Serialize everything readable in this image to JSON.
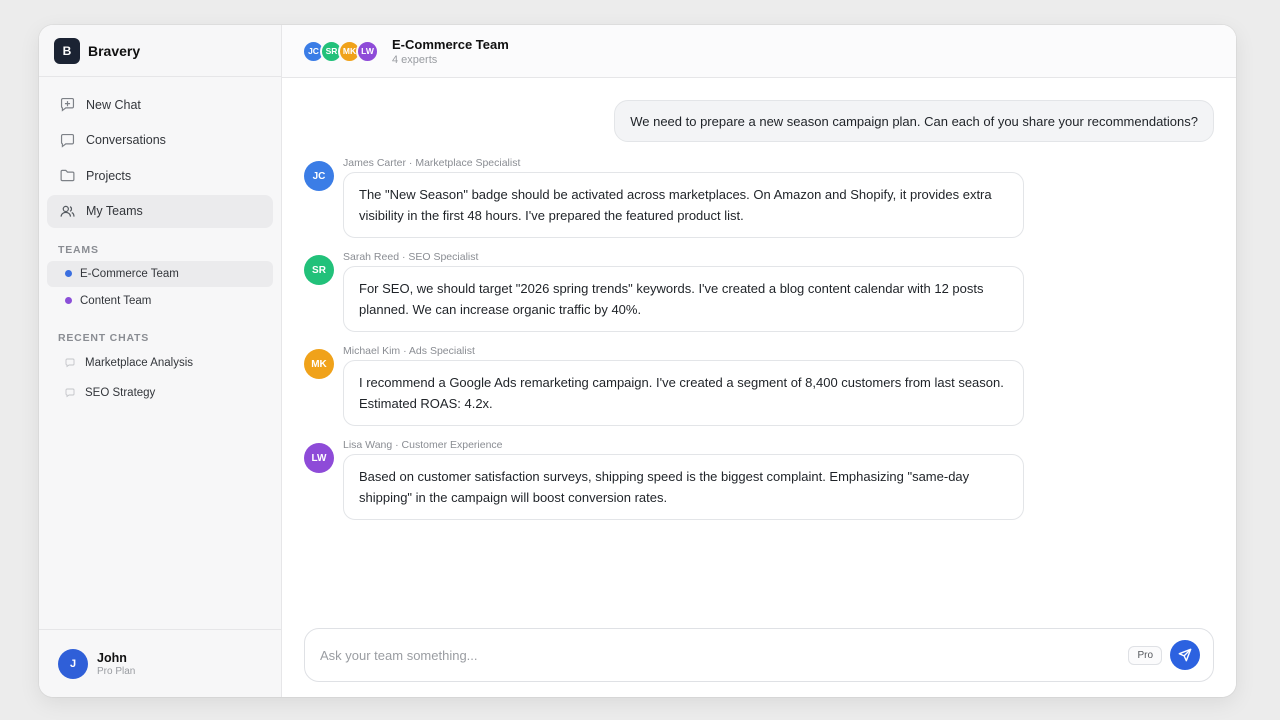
{
  "brand": {
    "logo_letter": "B",
    "name": "Bravery"
  },
  "nav": [
    {
      "label": "New Chat",
      "icon": "new-chat-icon"
    },
    {
      "label": "Conversations",
      "icon": "conversations-icon"
    },
    {
      "label": "Projects",
      "icon": "folder-icon"
    },
    {
      "label": "My Teams",
      "icon": "users-icon",
      "active": true
    }
  ],
  "teams": {
    "label": "TEAMS",
    "items": [
      {
        "label": "E-Commerce Team",
        "color": "#3b6fe0",
        "active": true
      },
      {
        "label": "Content Team",
        "color": "#8b4fd8"
      }
    ]
  },
  "recent": {
    "label": "RECENT CHATS",
    "items": [
      {
        "label": "Marketplace Analysis"
      },
      {
        "label": "SEO Strategy"
      }
    ]
  },
  "user": {
    "initial": "J",
    "name": "John",
    "plan": "Pro Plan"
  },
  "header": {
    "title": "E-Commerce Team",
    "subtitle": "4 experts",
    "avatars": [
      {
        "initials": "JC",
        "color": "#3b7de6"
      },
      {
        "initials": "SR",
        "color": "#22c17a"
      },
      {
        "initials": "MK",
        "color": "#f0a21a"
      },
      {
        "initials": "LW",
        "color": "#8e4bd8"
      }
    ]
  },
  "user_message": "We need to prepare a new season campaign plan. Can each of you share your recommendations?",
  "messages": [
    {
      "initials": "JC",
      "color": "#3b7de6",
      "meta": "James Carter · Marketplace Specialist",
      "text": "The \"New Season\" badge should be activated across marketplaces. On Amazon and Shopify, it provides extra visibility in the first 48 hours. I've prepared the featured product list."
    },
    {
      "initials": "SR",
      "color": "#22c17a",
      "meta": "Sarah Reed · SEO Specialist",
      "text": "For SEO, we should target \"2026 spring trends\" keywords. I've created a blog content calendar with 12 posts planned. We can increase organic traffic by 40%."
    },
    {
      "initials": "MK",
      "color": "#f0a21a",
      "meta": "Michael Kim · Ads Specialist",
      "text": "I recommend a Google Ads remarketing campaign. I've created a segment of 8,400 customers from last season. Estimated ROAS: 4.2x."
    },
    {
      "initials": "LW",
      "color": "#8e4bd8",
      "meta": "Lisa Wang · Customer Experience",
      "text": "Based on customer satisfaction surveys, shipping speed is the biggest complaint. Emphasizing \"same-day shipping\" in the campaign will boost conversion rates."
    }
  ],
  "composer": {
    "placeholder": "Ask your team something...",
    "badge": "Pro"
  }
}
